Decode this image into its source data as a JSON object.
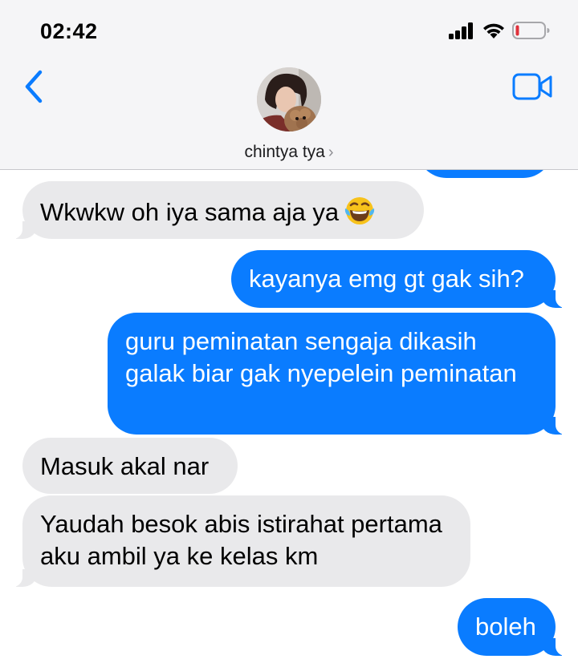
{
  "status_bar": {
    "time": "02:42"
  },
  "header": {
    "contact_name": "chintya tya",
    "chevron": "›",
    "back_icon": "chevron-left-icon",
    "video_icon": "video-camera-icon"
  },
  "colors": {
    "accent": "#0a7cff",
    "incoming_bubble": "#e9e9eb",
    "battery_low": "#e0313b"
  },
  "messages": [
    {
      "direction": "outgoing",
      "text": ""
    },
    {
      "direction": "incoming",
      "text": "Wkwkw oh iya sama aja ya",
      "emoji": "face-with-tears-of-joy-icon"
    },
    {
      "direction": "outgoing",
      "text": "kayanya emg gt gak sih?"
    },
    {
      "direction": "outgoing",
      "text": "guru peminatan sengaja dikasih galak biar gak nyepelein peminatan"
    },
    {
      "direction": "incoming",
      "text": "Masuk akal nar"
    },
    {
      "direction": "incoming",
      "text": "Yaudah besok abis istirahat pertama aku ambil ya ke kelas km"
    },
    {
      "direction": "outgoing",
      "text": "boleh"
    }
  ]
}
